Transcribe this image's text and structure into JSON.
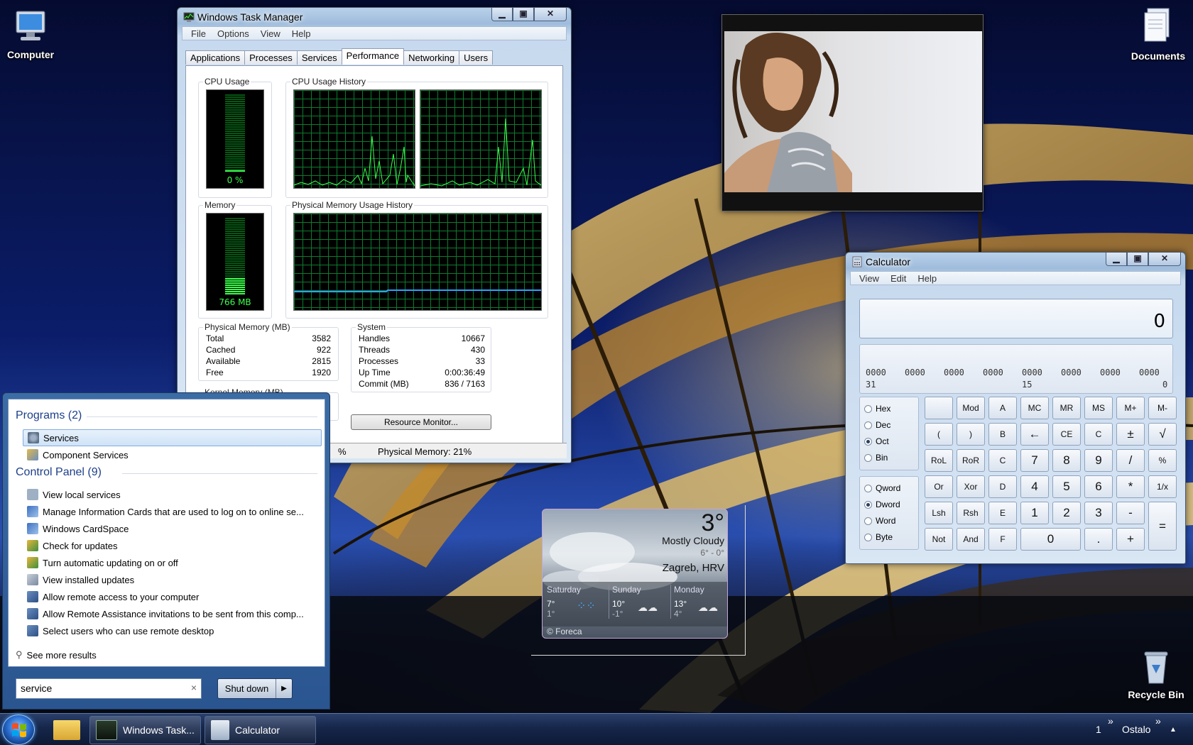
{
  "desktop": {
    "icons": [
      {
        "label": "Computer"
      },
      {
        "label": "Documents"
      },
      {
        "label": "Recycle Bin"
      }
    ]
  },
  "taskmgr": {
    "title": "Windows Task Manager",
    "menu": [
      "File",
      "Options",
      "View",
      "Help"
    ],
    "tabs": [
      "Applications",
      "Processes",
      "Services",
      "Performance",
      "Networking",
      "Users"
    ],
    "active_tab": "Performance",
    "cpu_usage_label": "CPU Usage",
    "cpu_usage_value": "0 %",
    "cpu_usage_percent": 0,
    "cpu_history_label": "CPU Usage History",
    "memory_label": "Memory",
    "memory_value": "766 MB",
    "memory_fill_percent": 21,
    "phys_history_label": "Physical Memory Usage History",
    "physical_memory": {
      "label": "Physical Memory (MB)",
      "rows": [
        {
          "k": "Total",
          "v": "3582"
        },
        {
          "k": "Cached",
          "v": "922"
        },
        {
          "k": "Available",
          "v": "2815"
        },
        {
          "k": "Free",
          "v": "1920"
        }
      ]
    },
    "system": {
      "label": "System",
      "rows": [
        {
          "k": "Handles",
          "v": "10667"
        },
        {
          "k": "Threads",
          "v": "430"
        },
        {
          "k": "Processes",
          "v": "33"
        },
        {
          "k": "Up Time",
          "v": "0:00:36:49"
        },
        {
          "k": "Commit (MB)",
          "v": "836 / 7163"
        }
      ]
    },
    "kernel_memory_label": "Kernel Memory (MB)",
    "resource_monitor_button": "Resource Monitor...",
    "status_left_fragment": "%",
    "status_physical": "Physical Memory: 21%"
  },
  "calculator": {
    "title": "Calculator",
    "menu": [
      "View",
      "Edit",
      "Help"
    ],
    "display": "0",
    "bit_groups": [
      "0000",
      "0000",
      "0000",
      "0000",
      "0000",
      "0000",
      "0000",
      "0000"
    ],
    "bit_markers": [
      "31",
      "15",
      "0"
    ],
    "radix": [
      {
        "label": "Hex",
        "selected": false
      },
      {
        "label": "Dec",
        "selected": false
      },
      {
        "label": "Oct",
        "selected": true
      },
      {
        "label": "Bin",
        "selected": false
      }
    ],
    "word_size": [
      {
        "label": "Qword",
        "selected": false
      },
      {
        "label": "Dword",
        "selected": true
      },
      {
        "label": "Word",
        "selected": false
      },
      {
        "label": "Byte",
        "selected": false
      }
    ],
    "keys": [
      [
        "",
        "Mod",
        "A",
        "MC",
        "MR",
        "MS",
        "M+",
        "M-"
      ],
      [
        "(",
        ")",
        "B",
        "←",
        "CE",
        "C",
        "±",
        "√"
      ],
      [
        "RoL",
        "RoR",
        "C",
        "7",
        "8",
        "9",
        "/",
        "%"
      ],
      [
        "Or",
        "Xor",
        "D",
        "4",
        "5",
        "6",
        "*",
        "1/x"
      ],
      [
        "Lsh",
        "Rsh",
        "E",
        "1",
        "2",
        "3",
        "-",
        "="
      ],
      [
        "Not",
        "And",
        "F",
        "0",
        "",
        ".",
        "+",
        ""
      ]
    ]
  },
  "weather": {
    "temp": "3°",
    "condition": "Mostly Cloudy",
    "range": "6° - 0°",
    "location": "Zagreb, HRV",
    "days": [
      {
        "day": "Saturday",
        "high": "7°",
        "low": "1°"
      },
      {
        "day": "Sunday",
        "high": "10°",
        "low": "-1°"
      },
      {
        "day": "Monday",
        "high": "13°",
        "low": "4°"
      }
    ],
    "provider": "© Foreca"
  },
  "startmenu": {
    "programs_header": "Programs (2)",
    "programs": [
      "Services",
      "Component Services"
    ],
    "control_panel_header": "Control Panel (9)",
    "control_panel": [
      "View local services",
      "Manage Information Cards that are used to log on to online se...",
      "Windows CardSpace",
      "Check for updates",
      "Turn automatic updating on or off",
      "View installed updates",
      "Allow remote access to your computer",
      "Allow Remote Assistance invitations to be sent from this comp...",
      "Select users who can use remote desktop"
    ],
    "see_more": "See more results",
    "search_value": "service",
    "clear_glyph": "×",
    "shutdown_label": "Shut down"
  },
  "taskbar": {
    "buttons": [
      {
        "label": ""
      },
      {
        "label": "Windows Task..."
      },
      {
        "label": "Calculator"
      }
    ],
    "tray_left": "1",
    "tray_chevron": "»",
    "tray_text": "Ostalo",
    "tray_chevron2": "»",
    "tray_up": "▲"
  }
}
